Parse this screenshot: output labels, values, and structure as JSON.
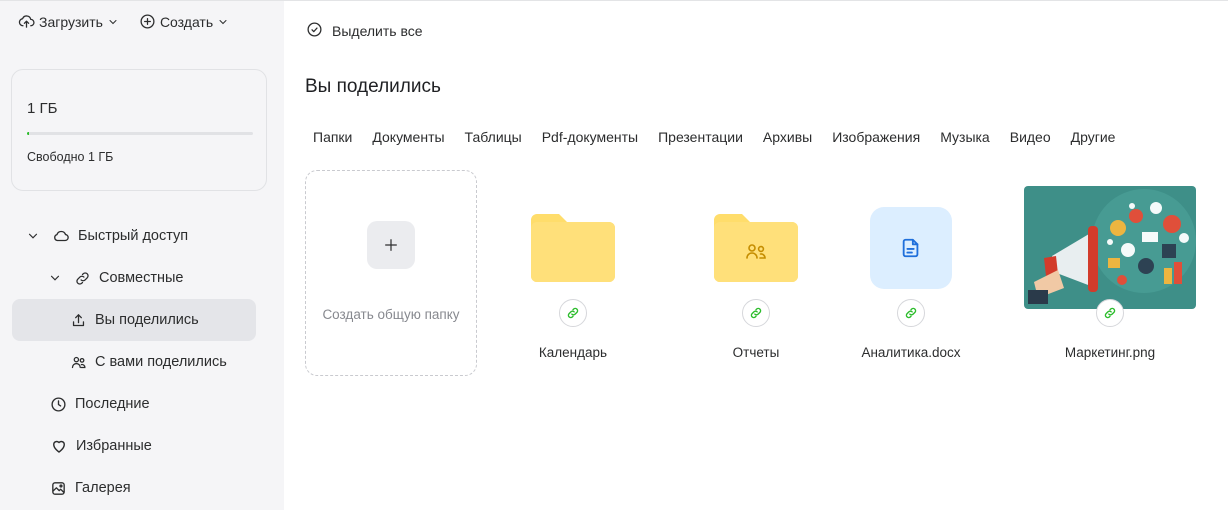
{
  "toolbar": {
    "upload_label": "Загрузить",
    "create_label": "Создать"
  },
  "storage": {
    "size": "1 ГБ",
    "free": "Свободно 1 ГБ",
    "used_fraction": 0.01
  },
  "nav": {
    "quick_access": "Быстрый доступ",
    "shared": "Совместные",
    "you_shared": "Вы поделились",
    "shared_with_you": "С вами поделились",
    "recent": "Последние",
    "favorites": "Избранные",
    "gallery": "Галерея"
  },
  "main": {
    "select_all": "Выделить все",
    "title": "Вы поделились",
    "filters": [
      "Папки",
      "Документы",
      "Таблицы",
      "Pdf-документы",
      "Презентации",
      "Архивы",
      "Изображения",
      "Музыка",
      "Видео",
      "Другие"
    ],
    "create_shared_folder": "Создать общую папку",
    "items": [
      {
        "name": "Календарь",
        "type": "folder"
      },
      {
        "name": "Отчеты",
        "type": "shared-folder"
      },
      {
        "name": "Аналитика.docx",
        "type": "document"
      },
      {
        "name": "Маркетинг.png",
        "type": "image"
      }
    ]
  },
  "colors": {
    "accent": "#2dbd2d",
    "folder": "#ffdd6b",
    "doc_bg": "#dceeff",
    "doc_icon": "#1f6fdb",
    "active_nav": "#e4e5e9"
  }
}
